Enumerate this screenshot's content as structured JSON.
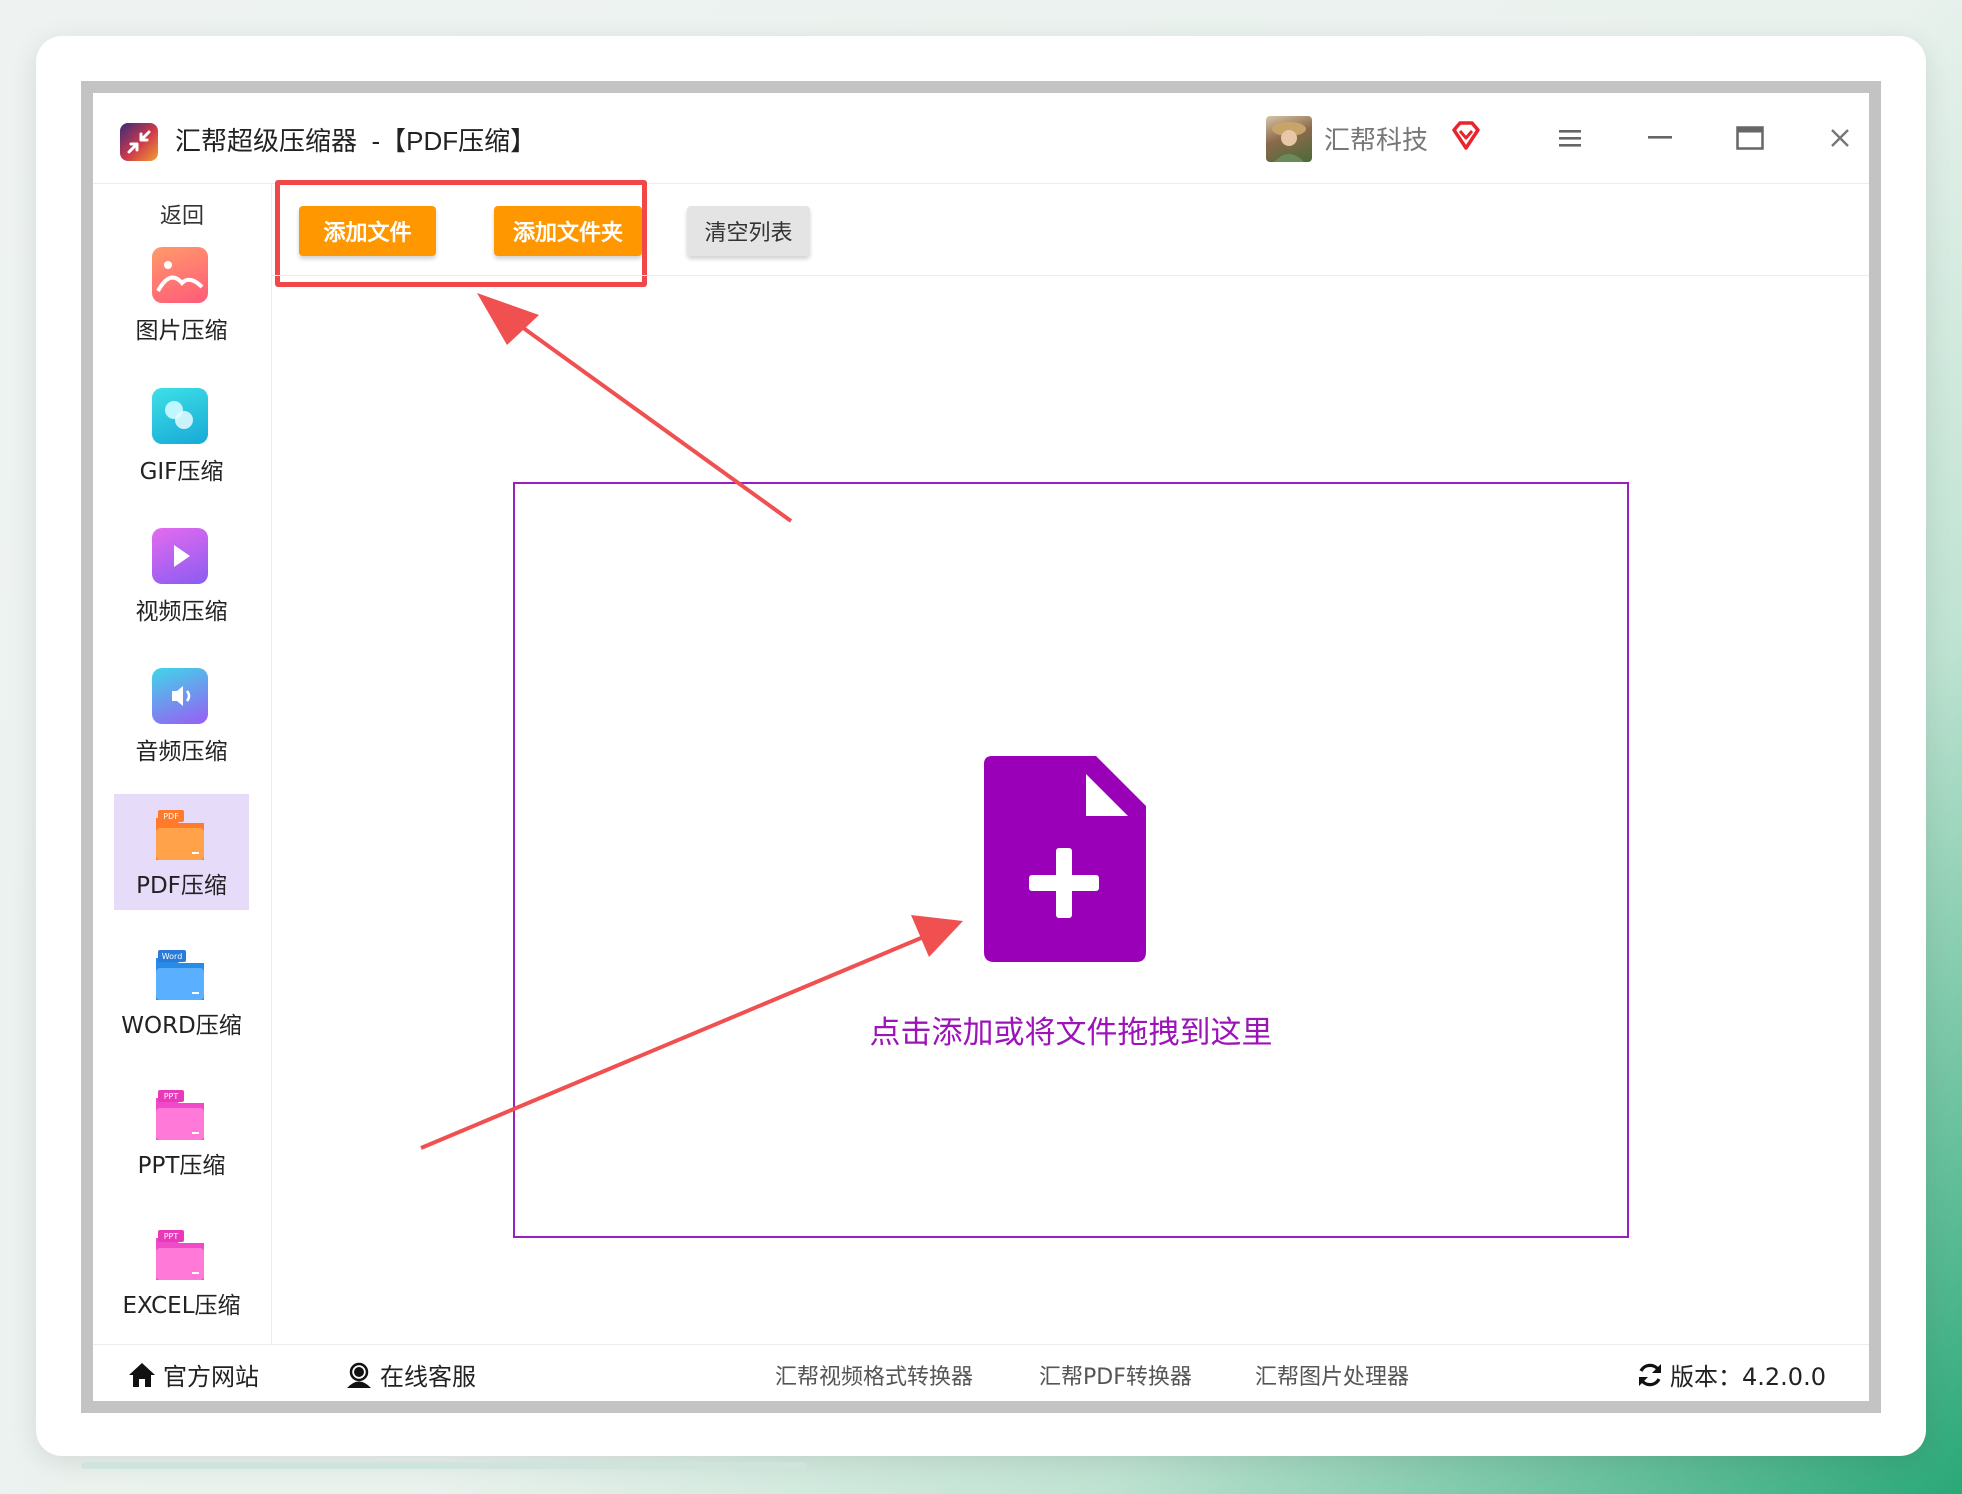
{
  "app": {
    "title": "汇帮超级压缩器  -【PDF压缩】",
    "user_name": "汇帮科技"
  },
  "sidebar": {
    "back_label": "返回",
    "items": [
      {
        "label": "图片压缩",
        "icon": "image-compress-icon",
        "active": false
      },
      {
        "label": "GIF压缩",
        "icon": "gif-compress-icon",
        "active": false
      },
      {
        "label": "视频压缩",
        "icon": "video-compress-icon",
        "active": false
      },
      {
        "label": "音频压缩",
        "icon": "audio-compress-icon",
        "active": false
      },
      {
        "label": "PDF压缩",
        "icon": "pdf-compress-icon",
        "active": true
      },
      {
        "label": "WORD压缩",
        "icon": "word-compress-icon",
        "active": false
      },
      {
        "label": "PPT压缩",
        "icon": "ppt-compress-icon",
        "active": false
      },
      {
        "label": "EXCEL压缩",
        "icon": "excel-compress-icon",
        "active": false
      }
    ]
  },
  "toolbar": {
    "add_file_label": "添加文件",
    "add_folder_label": "添加文件夹",
    "clear_label": "清空列表"
  },
  "dropzone": {
    "hint": "点击添加或将文件拖拽到这里"
  },
  "footer": {
    "website_label": "官方网站",
    "service_label": "在线客服",
    "products": [
      "汇帮视频格式转换器",
      "汇帮PDF转换器",
      "汇帮图片处理器"
    ],
    "version_label": "版本：4.2.0.0"
  },
  "colors": {
    "accent_orange": "#ff9700",
    "drop_purple": "#9c14b8",
    "highlight_red": "#f04848",
    "active_tab": "#e6dcfa"
  }
}
